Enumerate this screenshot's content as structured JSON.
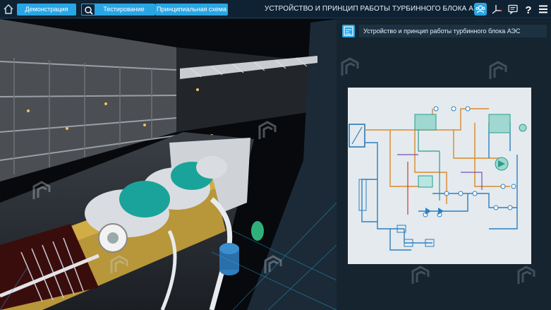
{
  "toolbar": {
    "tabs": [
      {
        "label": "Демонстрация"
      },
      {
        "label": "Тестирование"
      },
      {
        "label": "Принципиальная схема"
      }
    ],
    "title": "УСТРОЙСТВО И ПРИНЦИП РАБОТЫ ТУРБИННОГО БЛОКА АЭС",
    "icons": [
      "user-group-icon",
      "axes-icon",
      "chat-icon",
      "help-icon",
      "menu-icon"
    ]
  },
  "panel": {
    "title": "Устройство и принцип работы турбинного блока АЭС",
    "icon": "scheme-icon"
  },
  "colors": {
    "accent": "#2aa5e3",
    "topbar": "#0f2233",
    "panel": "#15242f",
    "diagram_bg": "#e4eaee",
    "pipe_blue": "#2e7fbf",
    "pipe_orange": "#d9892b",
    "pipe_teal": "#2a9c8c"
  }
}
